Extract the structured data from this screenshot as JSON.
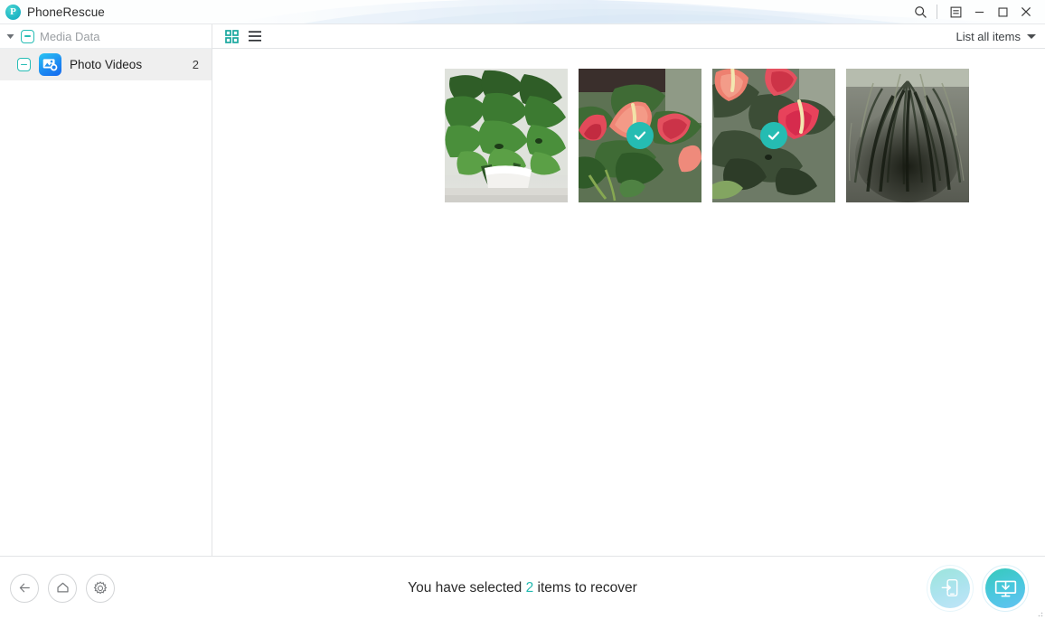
{
  "window": {
    "title": "PhoneRescue",
    "logo_letter": "P",
    "controls": {
      "search": "search-icon",
      "menu": "menu-icon",
      "minimize": "minimize-icon",
      "maximize": "maximize-icon",
      "close": "close-icon"
    }
  },
  "sidebar": {
    "group": {
      "label": "Media Data",
      "expanded": true,
      "checkbox_state": "indeterminate"
    },
    "items": [
      {
        "label": "Photo Videos",
        "count": "2",
        "icon": "photo-videos-icon",
        "checkbox_state": "indeterminate",
        "selected": true
      }
    ]
  },
  "toolbar": {
    "grid_view_icon": "grid-view-icon",
    "list_view_icon": "list-view-icon",
    "active_view": "grid",
    "sort_label": "List all items"
  },
  "gallery": {
    "items": [
      {
        "name": "potted green houseplant",
        "selected": false
      },
      {
        "name": "pink anthurium flowers",
        "selected": true
      },
      {
        "name": "pink anthurium with dark leaves",
        "selected": true
      },
      {
        "name": "dark grassy plant",
        "selected": false
      }
    ]
  },
  "footer": {
    "back_label": "back-arrow-icon",
    "home_label": "home-icon",
    "settings_label": "gear-icon",
    "status_prefix": "You have selected",
    "status_count": "2",
    "status_suffix": "items to recover",
    "recover_to_device_label": "recover-to-device-icon",
    "recover_to_computer_label": "recover-to-computer-icon"
  },
  "colors": {
    "accent_teal": "#22b9b0",
    "check_badge": "#25bcb2",
    "icon_blue": "#1e8df2",
    "sidebar_selected": "#efefef"
  }
}
